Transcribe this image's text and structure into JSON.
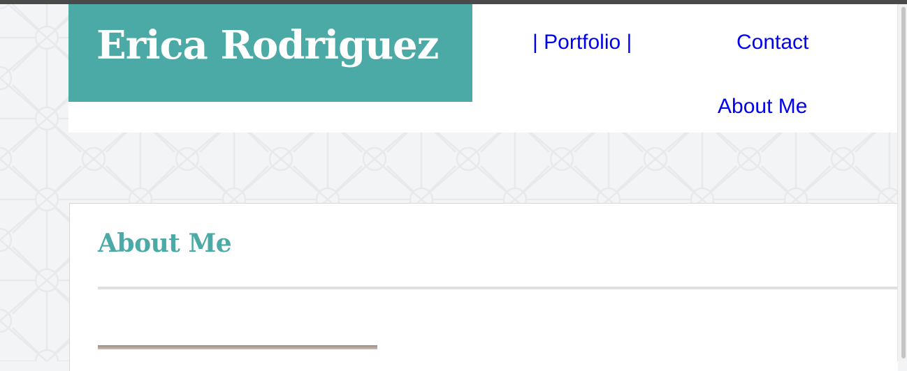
{
  "header": {
    "site_name": "Erica Rodriguez",
    "nav": {
      "portfolio": "| Portfolio |",
      "contact": "Contact",
      "about": "About Me"
    }
  },
  "main": {
    "section_title": "About Me"
  },
  "colors": {
    "accent": "#4caaa6",
    "link": "#0000ee",
    "page_background": "#f3f4f6"
  }
}
